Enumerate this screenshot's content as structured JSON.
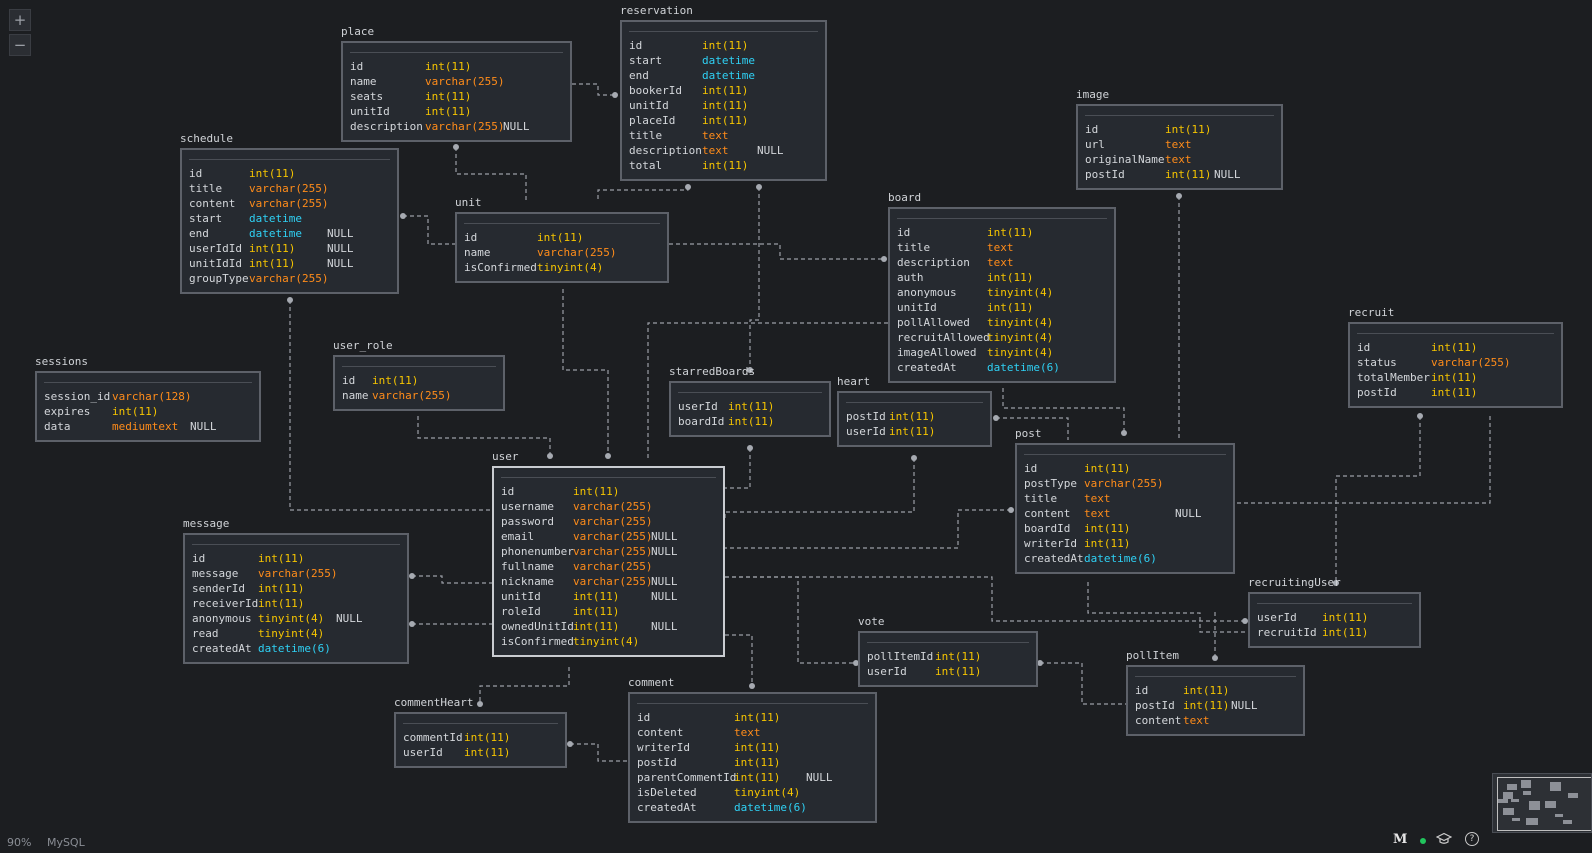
{
  "app": {
    "zoom": "90%",
    "dialect": "MySQL"
  },
  "controls": {
    "zoom_in": "+",
    "zoom_out": "−",
    "brand": "M",
    "help": "?"
  },
  "tables": [
    {
      "key": "place",
      "name": "place",
      "columns": [
        [
          "id",
          "int(11)",
          ""
        ],
        [
          "name",
          "varchar(255)",
          ""
        ],
        [
          "seats",
          "int(11)",
          ""
        ],
        [
          "unitId",
          "int(11)",
          ""
        ],
        [
          "description",
          "varchar(255)",
          "NULL"
        ]
      ]
    },
    {
      "key": "reservation",
      "name": "reservation",
      "columns": [
        [
          "id",
          "int(11)",
          ""
        ],
        [
          "start",
          "datetime",
          ""
        ],
        [
          "end",
          "datetime",
          ""
        ],
        [
          "bookerId",
          "int(11)",
          ""
        ],
        [
          "unitId",
          "int(11)",
          ""
        ],
        [
          "placeId",
          "int(11)",
          ""
        ],
        [
          "title",
          "text",
          ""
        ],
        [
          "description",
          "text",
          "NULL"
        ],
        [
          "total",
          "int(11)",
          ""
        ]
      ]
    },
    {
      "key": "schedule",
      "name": "schedule",
      "columns": [
        [
          "id",
          "int(11)",
          ""
        ],
        [
          "title",
          "varchar(255)",
          ""
        ],
        [
          "content",
          "varchar(255)",
          ""
        ],
        [
          "start",
          "datetime",
          ""
        ],
        [
          "end",
          "datetime",
          "NULL"
        ],
        [
          "userIdId",
          "int(11)",
          "NULL"
        ],
        [
          "unitIdId",
          "int(11)",
          "NULL"
        ],
        [
          "groupType",
          "varchar(255)",
          ""
        ]
      ]
    },
    {
      "key": "unit",
      "name": "unit",
      "columns": [
        [
          "id",
          "int(11)",
          ""
        ],
        [
          "name",
          "varchar(255)",
          ""
        ],
        [
          "isConfirmed",
          "tinyint(4)",
          ""
        ]
      ]
    },
    {
      "key": "image",
      "name": "image",
      "columns": [
        [
          "id",
          "int(11)",
          ""
        ],
        [
          "url",
          "text",
          ""
        ],
        [
          "originalName",
          "text",
          ""
        ],
        [
          "postId",
          "int(11)",
          "NULL"
        ]
      ]
    },
    {
      "key": "board",
      "name": "board",
      "columns": [
        [
          "id",
          "int(11)",
          ""
        ],
        [
          "title",
          "text",
          ""
        ],
        [
          "description",
          "text",
          ""
        ],
        [
          "auth",
          "int(11)",
          ""
        ],
        [
          "anonymous",
          "tinyint(4)",
          ""
        ],
        [
          "unitId",
          "int(11)",
          ""
        ],
        [
          "pollAllowed",
          "tinyint(4)",
          ""
        ],
        [
          "recruitAllowed",
          "tinyint(4)",
          ""
        ],
        [
          "imageAllowed",
          "tinyint(4)",
          ""
        ],
        [
          "createdAt",
          "datetime(6)",
          ""
        ]
      ]
    },
    {
      "key": "recruit",
      "name": "recruit",
      "columns": [
        [
          "id",
          "int(11)",
          ""
        ],
        [
          "status",
          "varchar(255)",
          ""
        ],
        [
          "totalMember",
          "int(11)",
          ""
        ],
        [
          "postId",
          "int(11)",
          ""
        ]
      ]
    },
    {
      "key": "sessions",
      "name": "sessions",
      "columns": [
        [
          "session_id",
          "varchar(128)",
          ""
        ],
        [
          "expires",
          "int(11)",
          ""
        ],
        [
          "data",
          "mediumtext",
          "NULL"
        ]
      ]
    },
    {
      "key": "user_role",
      "name": "user_role",
      "columns": [
        [
          "id",
          "int(11)",
          ""
        ],
        [
          "name",
          "varchar(255)",
          ""
        ]
      ]
    },
    {
      "key": "starredBoards",
      "name": "starredBoards",
      "columns": [
        [
          "userId",
          "int(11)",
          ""
        ],
        [
          "boardId",
          "int(11)",
          ""
        ]
      ]
    },
    {
      "key": "heart",
      "name": "heart",
      "columns": [
        [
          "postId",
          "int(11)",
          ""
        ],
        [
          "userId",
          "int(11)",
          ""
        ]
      ]
    },
    {
      "key": "post",
      "name": "post",
      "columns": [
        [
          "id",
          "int(11)",
          ""
        ],
        [
          "postType",
          "varchar(255)",
          ""
        ],
        [
          "title",
          "text",
          ""
        ],
        [
          "content",
          "text",
          "NULL"
        ],
        [
          "boardId",
          "int(11)",
          ""
        ],
        [
          "writerId",
          "int(11)",
          ""
        ],
        [
          "createdAt",
          "datetime(6)",
          ""
        ]
      ]
    },
    {
      "key": "user",
      "name": "user",
      "columns": [
        [
          "id",
          "int(11)",
          ""
        ],
        [
          "username",
          "varchar(255)",
          ""
        ],
        [
          "password",
          "varchar(255)",
          ""
        ],
        [
          "email",
          "varchar(255)",
          "NULL"
        ],
        [
          "phonenumber",
          "varchar(255)",
          "NULL"
        ],
        [
          "fullname",
          "varchar(255)",
          ""
        ],
        [
          "nickname",
          "varchar(255)",
          "NULL"
        ],
        [
          "unitId",
          "int(11)",
          "NULL"
        ],
        [
          "roleId",
          "int(11)",
          ""
        ],
        [
          "ownedUnitId",
          "int(11)",
          "NULL"
        ],
        [
          "isConfirmed",
          "tinyint(4)",
          ""
        ]
      ]
    },
    {
      "key": "message",
      "name": "message",
      "columns": [
        [
          "id",
          "int(11)",
          ""
        ],
        [
          "message",
          "varchar(255)",
          ""
        ],
        [
          "senderId",
          "int(11)",
          ""
        ],
        [
          "receiverId",
          "int(11)",
          ""
        ],
        [
          "anonymous",
          "tinyint(4)",
          "NULL"
        ],
        [
          "read",
          "tinyint(4)",
          ""
        ],
        [
          "createdAt",
          "datetime(6)",
          ""
        ]
      ]
    },
    {
      "key": "recruitingUser",
      "name": "recruitingUser",
      "columns": [
        [
          "userId",
          "int(11)",
          ""
        ],
        [
          "recruitId",
          "int(11)",
          ""
        ]
      ]
    },
    {
      "key": "vote",
      "name": "vote",
      "columns": [
        [
          "pollItemId",
          "int(11)",
          ""
        ],
        [
          "userId",
          "int(11)",
          ""
        ]
      ]
    },
    {
      "key": "pollItem",
      "name": "pollItem",
      "columns": [
        [
          "id",
          "int(11)",
          ""
        ],
        [
          "postId",
          "int(11)",
          "NULL"
        ],
        [
          "content",
          "text",
          ""
        ]
      ]
    },
    {
      "key": "commentHeart",
      "name": "commentHeart",
      "columns": [
        [
          "commentId",
          "int(11)",
          ""
        ],
        [
          "userId",
          "int(11)",
          ""
        ]
      ]
    },
    {
      "key": "comment",
      "name": "comment",
      "columns": [
        [
          "id",
          "int(11)",
          ""
        ],
        [
          "content",
          "text",
          ""
        ],
        [
          "writerId",
          "int(11)",
          ""
        ],
        [
          "postId",
          "int(11)",
          ""
        ],
        [
          "parentCommentId",
          "int(11)",
          "NULL"
        ],
        [
          "isDeleted",
          "tinyint(4)",
          ""
        ],
        [
          "createdAt",
          "datetime(6)",
          ""
        ]
      ]
    }
  ],
  "colors": {
    "background": "#1c1e21",
    "int": "#f5c400",
    "varchar": "#ff8c1a",
    "datetime": "#2fd1f5",
    "connector": "#9a9ea6"
  }
}
